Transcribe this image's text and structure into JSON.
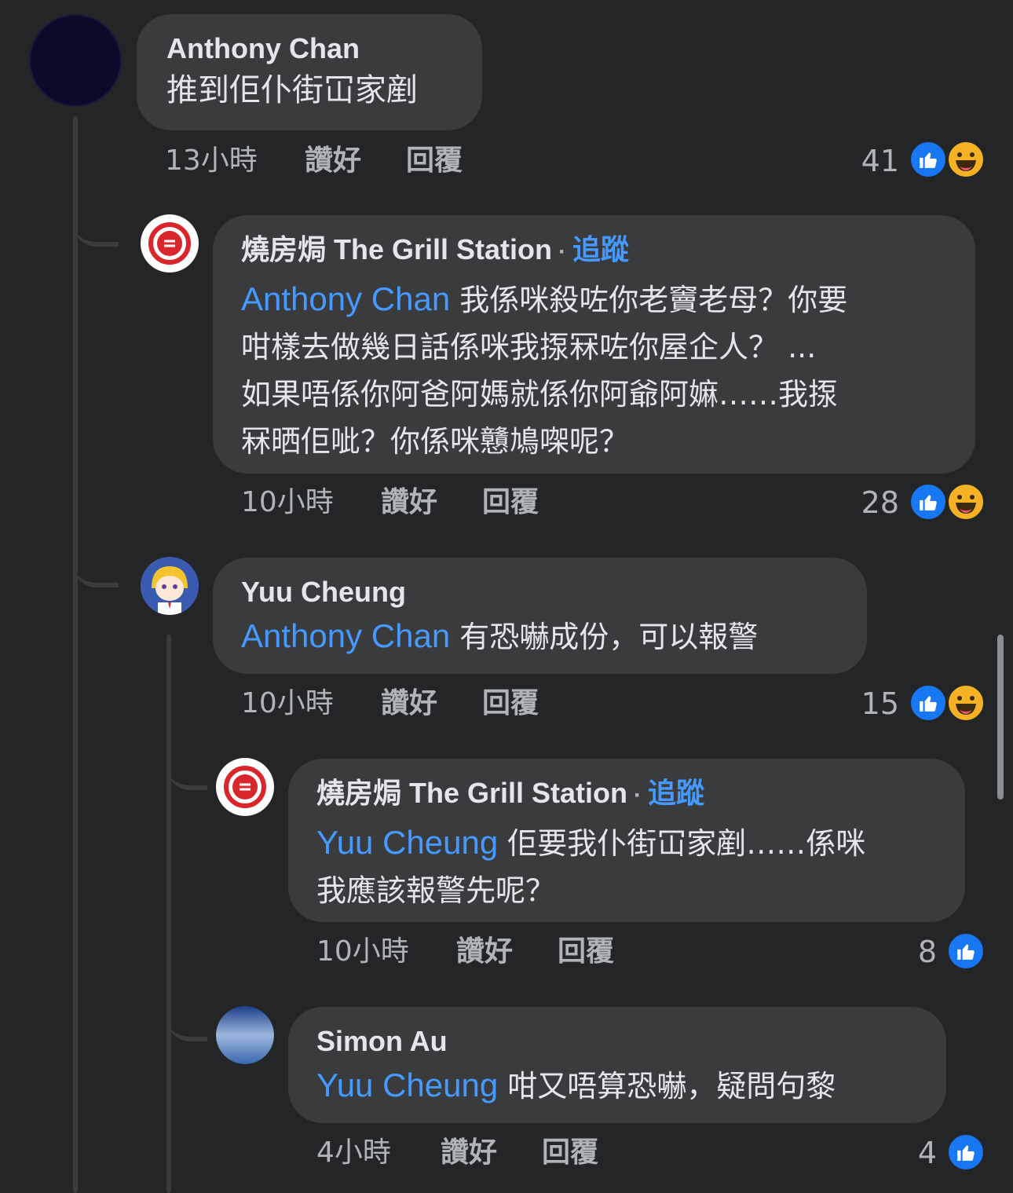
{
  "comments": [
    {
      "author": "Anthony Chan",
      "text": "推到佢仆街冚家剷",
      "time": "13小時",
      "like_label": "讚好",
      "reply_label": "回覆",
      "reaction_count": "41"
    },
    {
      "author": "燒房焗 The Grill Station",
      "follow_label": "追蹤",
      "mention": "Anthony Chan",
      "text_line1": " 我係咪殺咗你老竇老母？你要",
      "text_line2": "咁樣去做幾日話係咪我揼冧咗你屋企人？ ...",
      "text_line3": "如果唔係你阿爸阿媽就係你阿爺阿嫲……我揼",
      "text_line4": "冧晒佢呲？你係咪戇鳩㗎呢？",
      "time": "10小時",
      "like_label": "讚好",
      "reply_label": "回覆",
      "reaction_count": "28"
    },
    {
      "author": "Yuu Cheung",
      "mention": "Anthony Chan",
      "text": " 有恐嚇成份，可以報警",
      "time": "10小時",
      "like_label": "讚好",
      "reply_label": "回覆",
      "reaction_count": "15"
    },
    {
      "author": "燒房焗 The Grill Station",
      "follow_label": "追蹤",
      "mention": "Yuu Cheung",
      "text_line1": " 佢要我仆街冚家剷……係咪",
      "text_line2": "我應該報警先呢？",
      "time": "10小時",
      "like_label": "讚好",
      "reply_label": "回覆",
      "reaction_count": "8"
    },
    {
      "author": "Simon Au",
      "mention": "Yuu Cheung",
      "text": " 咁又唔算恐嚇，疑問句黎",
      "time": "4小時",
      "like_label": "讚好",
      "reply_label": "回覆",
      "reaction_count": "4"
    }
  ],
  "colors": {
    "background": "#242526",
    "bubble": "#3a3b3c",
    "link": "#4599ff",
    "like_blue": "#1877f2",
    "haha_yellow": "#f7b125"
  },
  "icons": [
    "like-icon",
    "haha-icon"
  ]
}
